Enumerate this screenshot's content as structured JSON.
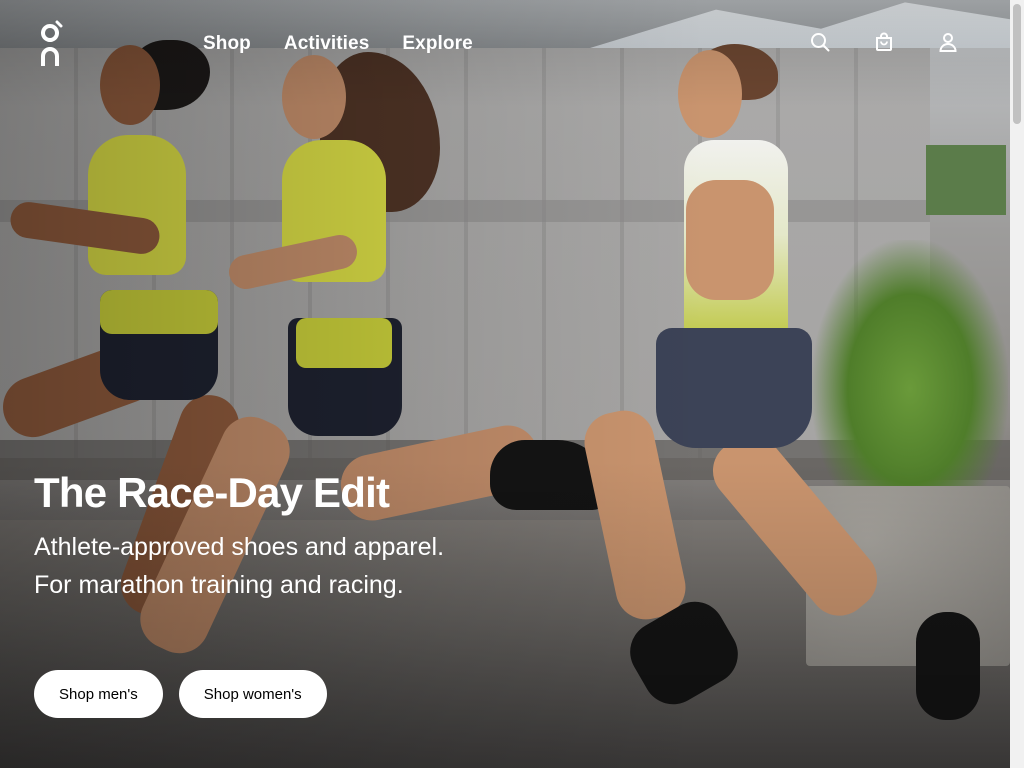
{
  "header": {
    "logo_icon": "on-brand-logo",
    "nav": [
      {
        "label": "Shop"
      },
      {
        "label": "Activities"
      },
      {
        "label": "Explore"
      }
    ],
    "icons": [
      "search-icon",
      "shopping-bag-icon",
      "account-icon"
    ]
  },
  "hero": {
    "title": "The Race-Day Edit",
    "subtitle": "Athlete-approved shoes and apparel. For marathon training and racing.",
    "buttons": [
      {
        "label": "Shop men's"
      },
      {
        "label": "Shop women's"
      }
    ]
  },
  "colors": {
    "cta_background": "#ffffff",
    "cta_text": "#000000",
    "nav_text": "#ffffff",
    "apparel_accent": "#d7da45"
  }
}
